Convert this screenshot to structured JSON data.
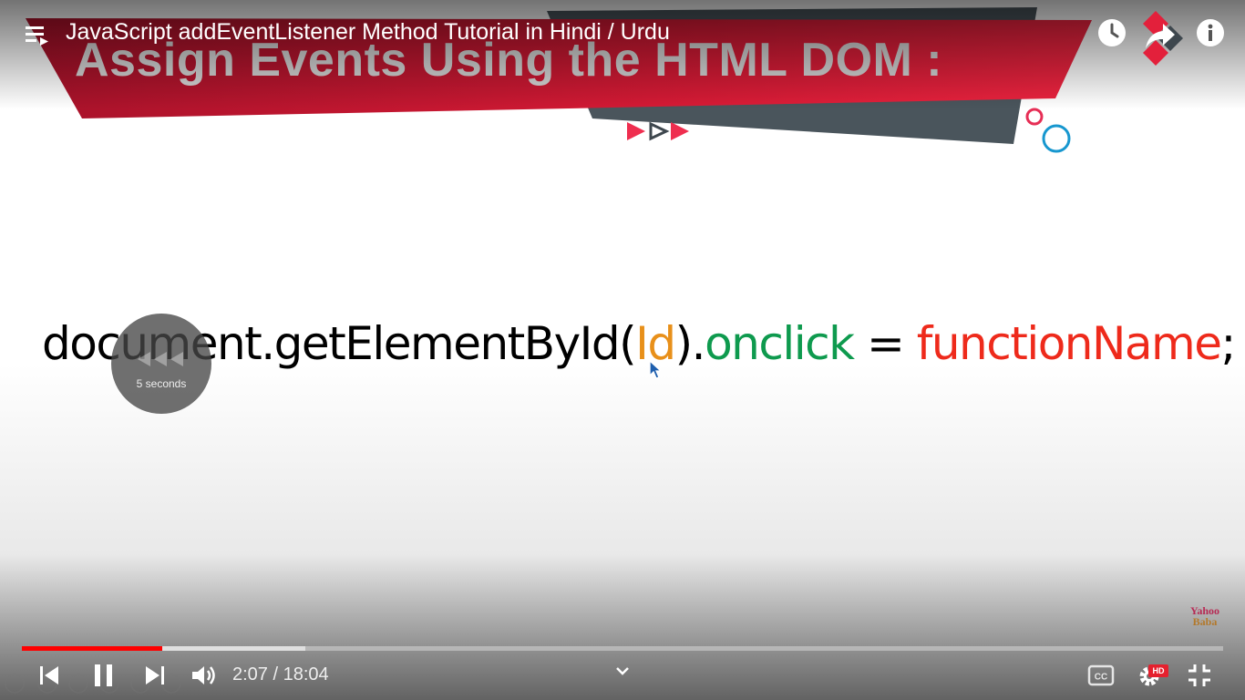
{
  "video": {
    "title": "JavaScript addEventListener Method Tutorial in Hindi / Urdu"
  },
  "slide": {
    "heading": "Assign Events Using the HTML DOM :",
    "code": {
      "part1": "document.getElementById(",
      "id": "Id",
      "part2": ").",
      "event": "onclick",
      "part3": " = ",
      "func": "functionName",
      "part4": ";"
    },
    "watermark": {
      "line1": "Yahoo",
      "line2": "Baba"
    }
  },
  "seek_overlay": {
    "label": "5 seconds"
  },
  "player": {
    "current_time": "2:07",
    "duration": "18:04",
    "time_display": "2:07 / 18:04",
    "progress_fraction": 0.117,
    "buffered_fraction": 0.236,
    "settings_badge": "HD",
    "controls": {
      "left": [
        "skip-previous-icon",
        "pause-icon",
        "skip-next-icon",
        "volume-icon"
      ],
      "center": [
        "chevron-down-icon"
      ],
      "right": [
        "captions-icon",
        "settings-icon",
        "exit-fullscreen-icon"
      ]
    }
  },
  "top_icons": [
    "playlist-icon",
    "watch-later-icon",
    "share-icon",
    "info-icon"
  ],
  "colors": {
    "banner_red": "#e3203b",
    "banner_dark": "#4a555c",
    "code_id": "#e8901a",
    "code_event": "#0e9a4e",
    "code_function": "#ee2a1b",
    "progress_red": "#ff0000",
    "deco_blue": "#1797cf"
  }
}
